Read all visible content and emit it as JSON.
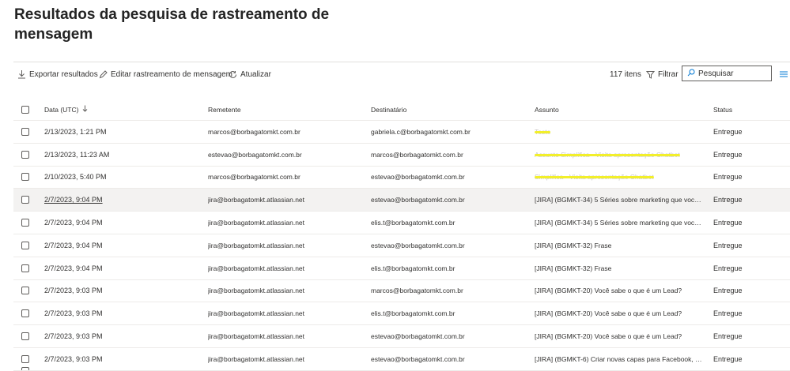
{
  "page": {
    "title": "Resultados da pesquisa de rastreamento de mensagem"
  },
  "toolbar": {
    "export": "Exportar resultados",
    "edit": "Editar rastreamento de mensagem",
    "refresh": "Atualizar",
    "count": "117 itens",
    "filter": "Filtrar",
    "search_placeholder": "Pesquisar"
  },
  "columns": {
    "date": "Data (UTC)",
    "sender": "Remetente",
    "recipient": "Destinatário",
    "subject": "Assunto",
    "status": "Status"
  },
  "rows": [
    {
      "date": "2/13/2023, 1:21 PM",
      "sender": "marcos@borbagatomkt.com.br",
      "recipient": "gabriela.c@borbagatomkt.com.br",
      "subject": "Teste",
      "status": "Entregue"
    },
    {
      "date": "2/13/2023, 11:23 AM",
      "sender": "estevao@borbagatomkt.com.br",
      "recipient": "marcos@borbagatomkt.com.br",
      "subject": "Assunto Simplifica - Visita apresentação Chatbot",
      "status": "Entregue"
    },
    {
      "date": "2/10/2023, 5:40 PM",
      "sender": "marcos@borbagatomkt.com.br",
      "recipient": "estevao@borbagatomkt.com.br",
      "subject": "Simplifica - Visita apresentação Chatbot",
      "status": "Entregue"
    },
    {
      "date": "2/7/2023, 9:04 PM",
      "sender": "jira@borbagatomkt.atlassian.net",
      "recipient": "estevao@borbagatomkt.com.br",
      "subject": "[JIRA] (BGMKT-34) 5 Séries sobre marketing que você precis...",
      "status": "Entregue"
    },
    {
      "date": "2/7/2023, 9:04 PM",
      "sender": "jira@borbagatomkt.atlassian.net",
      "recipient": "elis.t@borbagatomkt.com.br",
      "subject": "[JIRA] (BGMKT-34) 5 Séries sobre marketing que você precis...",
      "status": "Entregue"
    },
    {
      "date": "2/7/2023, 9:04 PM",
      "sender": "jira@borbagatomkt.atlassian.net",
      "recipient": "estevao@borbagatomkt.com.br",
      "subject": "[JIRA] (BGMKT-32) Frase",
      "status": "Entregue"
    },
    {
      "date": "2/7/2023, 9:04 PM",
      "sender": "jira@borbagatomkt.atlassian.net",
      "recipient": "elis.t@borbagatomkt.com.br",
      "subject": "[JIRA] (BGMKT-32) Frase",
      "status": "Entregue"
    },
    {
      "date": "2/7/2023, 9:03 PM",
      "sender": "jira@borbagatomkt.atlassian.net",
      "recipient": "marcos@borbagatomkt.com.br",
      "subject": "[JIRA] (BGMKT-20) Você sabe o que é um Lead?",
      "status": "Entregue"
    },
    {
      "date": "2/7/2023, 9:03 PM",
      "sender": "jira@borbagatomkt.atlassian.net",
      "recipient": "elis.t@borbagatomkt.com.br",
      "subject": "[JIRA] (BGMKT-20) Você sabe o que é um Lead?",
      "status": "Entregue"
    },
    {
      "date": "2/7/2023, 9:03 PM",
      "sender": "jira@borbagatomkt.atlassian.net",
      "recipient": "estevao@borbagatomkt.com.br",
      "subject": "[JIRA] (BGMKT-20) Você sabe o que é um Lead?",
      "status": "Entregue"
    },
    {
      "date": "2/7/2023, 9:03 PM",
      "sender": "jira@borbagatomkt.atlassian.net",
      "recipient": "estevao@borbagatomkt.com.br",
      "subject": "[JIRA] (BGMKT-6) Criar novas capas para Facebook, Istagram...",
      "status": "Entregue"
    }
  ],
  "hovered_row": 3,
  "redacted_rows": [
    0,
    1,
    2
  ],
  "colors": {
    "accent": "#0078d4",
    "highlight": "#f2ef2a",
    "hover_row": "#f3f2f1"
  },
  "icons": [
    "download-icon",
    "edit-icon",
    "refresh-icon",
    "filter-icon",
    "search-icon",
    "column-options-icon",
    "sort-down-icon"
  ]
}
